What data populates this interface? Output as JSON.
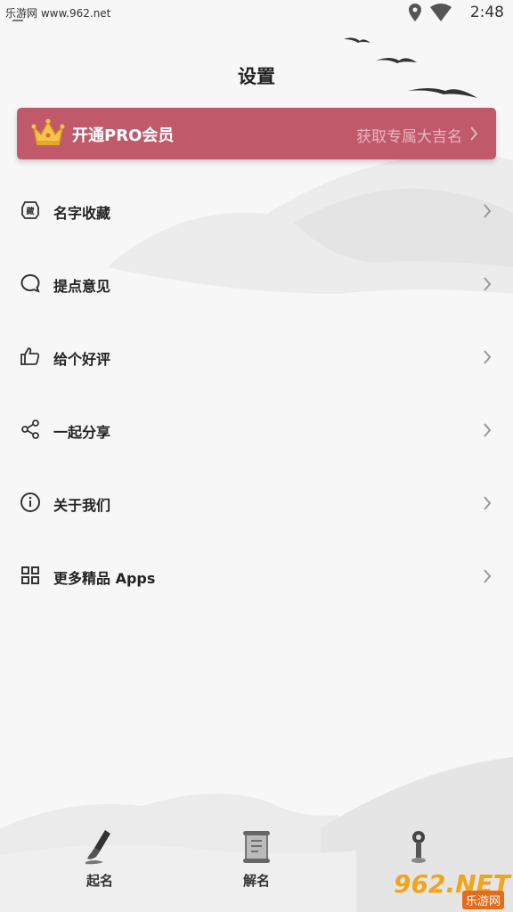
{
  "status_bar": {
    "watermark": "乐游网 www.962.net",
    "time": "2:48",
    "icons": [
      "location-icon",
      "wifi-icon",
      "battery-icon"
    ]
  },
  "page": {
    "title": "设置"
  },
  "pro_banner": {
    "label": "开通PRO会员",
    "subtitle": "获取专属大吉名",
    "icon": "crown-icon",
    "color": "#c05a6a"
  },
  "menu": [
    {
      "label": "名字收藏",
      "icon": "collection-seal-icon"
    },
    {
      "label": "提点意见",
      "icon": "chat-bubble-icon"
    },
    {
      "label": "给个好评",
      "icon": "thumbs-up-icon"
    },
    {
      "label": "一起分享",
      "icon": "share-icon"
    },
    {
      "label": "关于我们",
      "icon": "info-icon"
    },
    {
      "label": "更多精品 Apps",
      "icon": "grid-icon"
    }
  ],
  "bottom_nav": [
    {
      "label": "起名",
      "icon": "brush-icon"
    },
    {
      "label": "解名",
      "icon": "scroll-icon"
    },
    {
      "label": "",
      "icon": "settings-figure-icon"
    }
  ],
  "watermark_bottom": {
    "brand": "962.NET",
    "cn": "乐游网"
  }
}
